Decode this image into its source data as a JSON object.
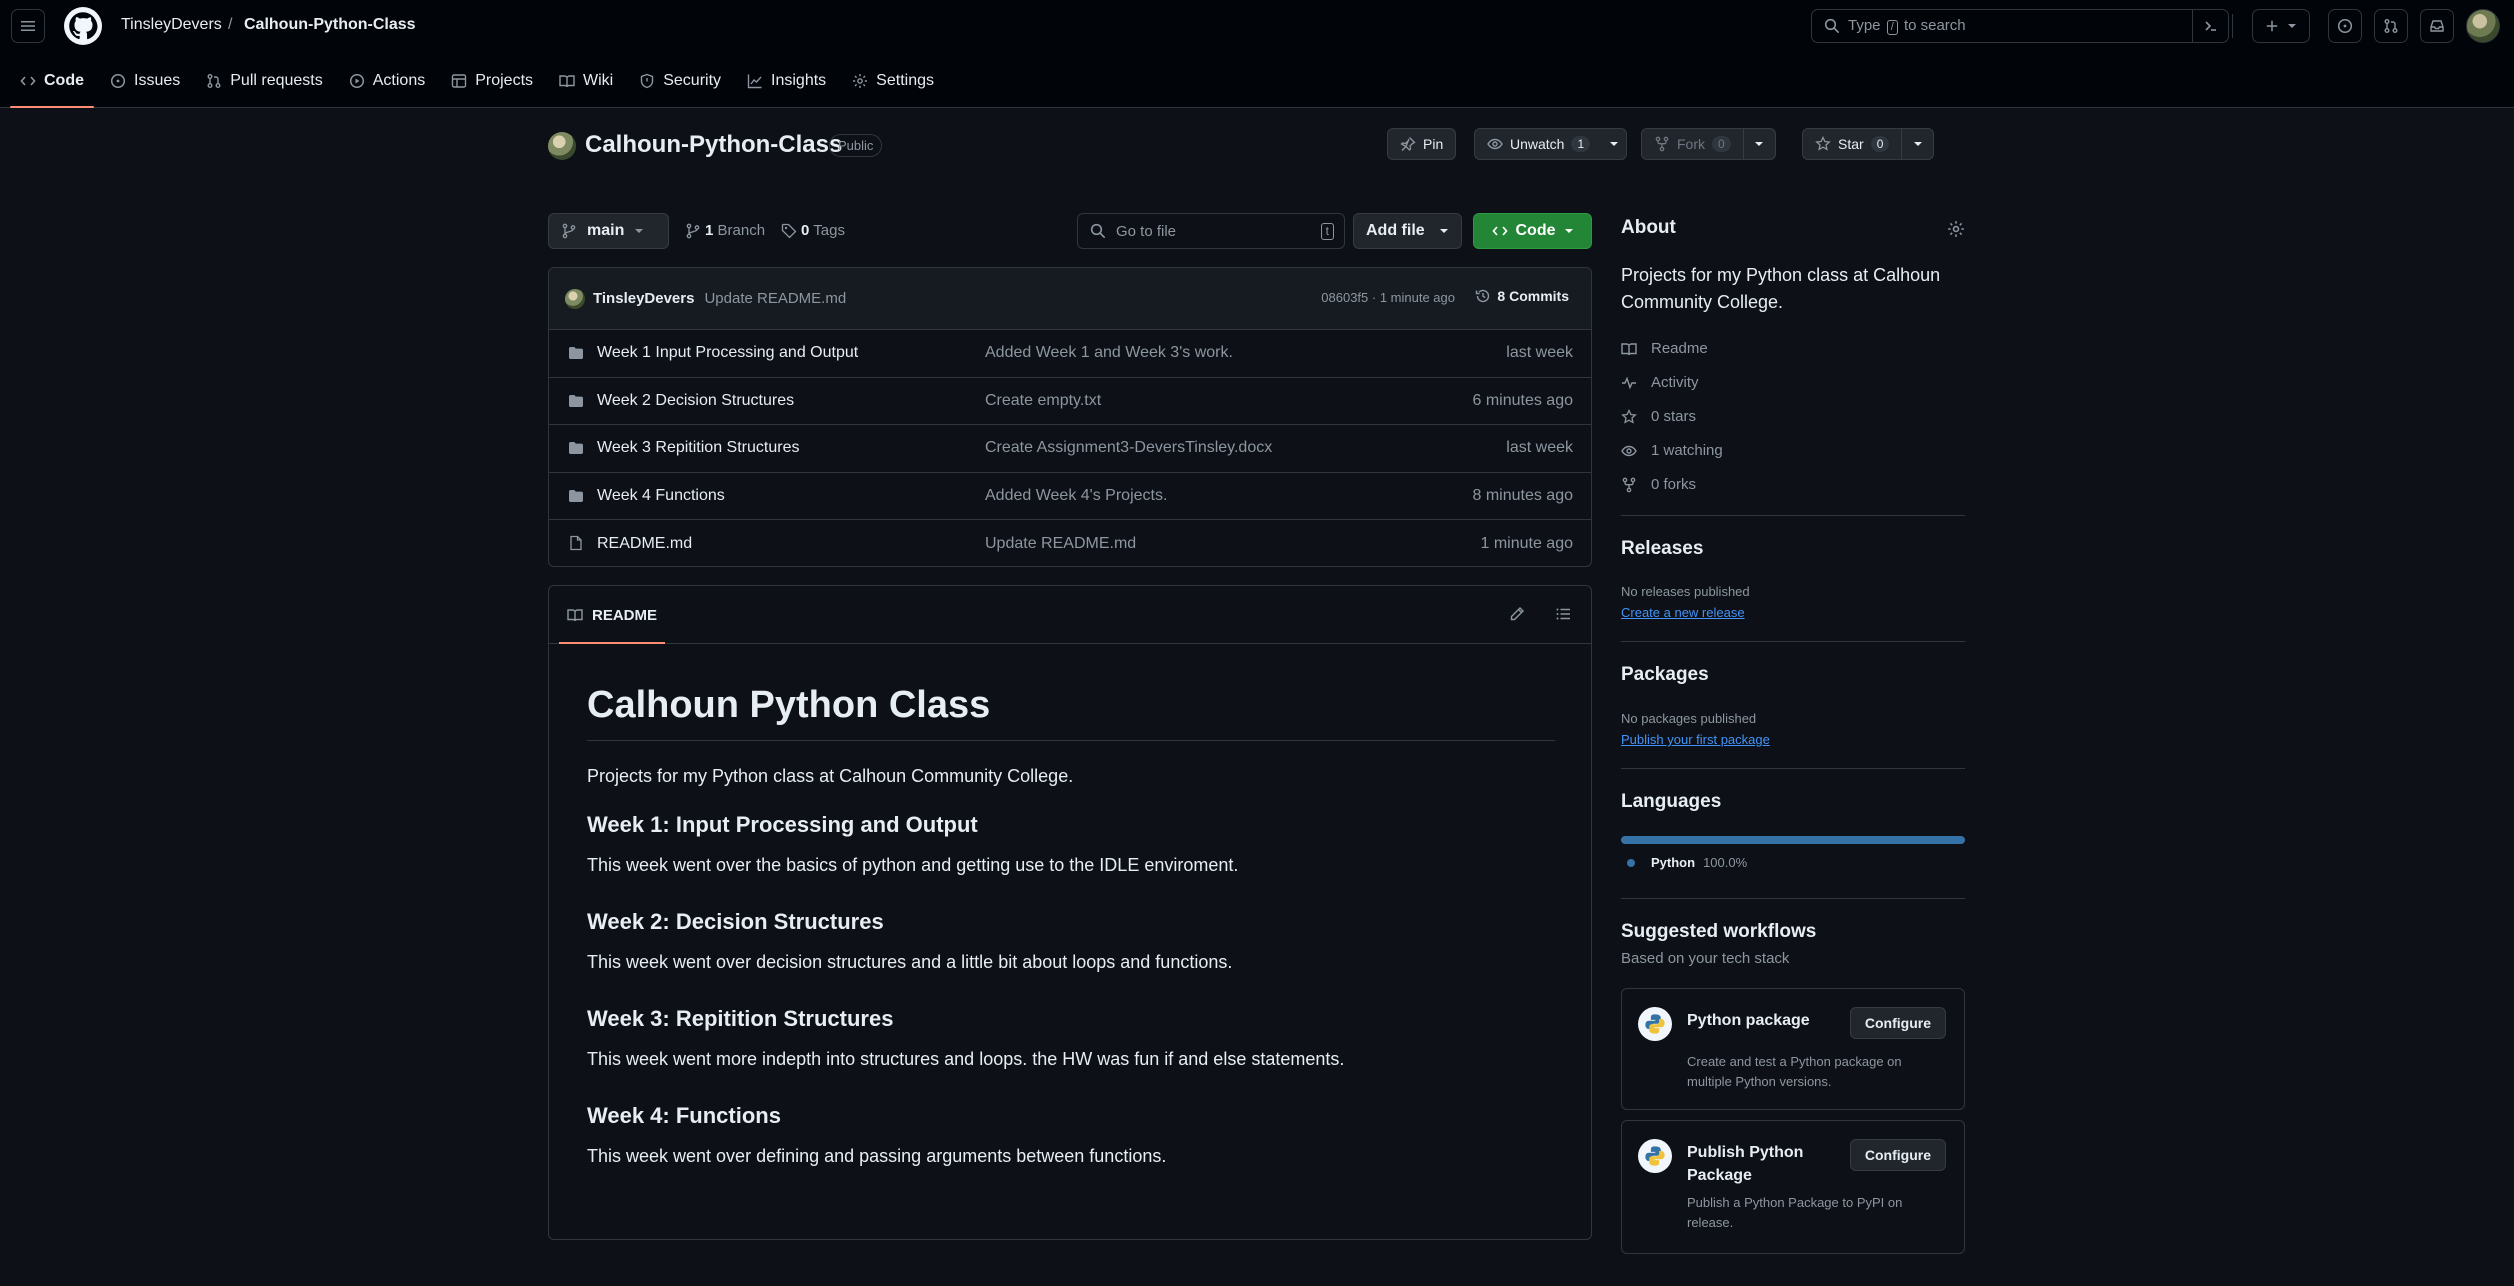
{
  "header": {
    "owner": "TinsleyDevers",
    "separator": "/",
    "repo": "Calhoun-Python-Class",
    "search_pre": "Type",
    "search_key": "/",
    "search_post": "to search"
  },
  "tabs": [
    {
      "label": "Code"
    },
    {
      "label": "Issues"
    },
    {
      "label": "Pull requests"
    },
    {
      "label": "Actions"
    },
    {
      "label": "Projects"
    },
    {
      "label": "Wiki"
    },
    {
      "label": "Security"
    },
    {
      "label": "Insights"
    },
    {
      "label": "Settings"
    }
  ],
  "repo": {
    "name": "Calhoun-Python-Class",
    "visibility": "Public",
    "pin_label": "Pin",
    "unwatch_label": "Unwatch",
    "watch_count": "1",
    "fork_label": "Fork",
    "fork_count": "0",
    "star_label": "Star",
    "star_count": "0"
  },
  "filenav": {
    "branch": "main",
    "branch_count": "1",
    "branch_label": "Branch",
    "tag_count": "0",
    "tag_label": "Tags",
    "goto_placeholder": "Go to file",
    "goto_key": "t",
    "add_file": "Add file",
    "code": "Code"
  },
  "commit": {
    "author": "TinsleyDevers",
    "message": "Update README.md",
    "meta": "08603f5 · 1 minute ago",
    "commits_label": "8 Commits"
  },
  "files": [
    {
      "type": "folder",
      "name": "Week 1 Input Processing and Output",
      "message": "Added Week 1 and Week 3's work.",
      "time": "last week"
    },
    {
      "type": "folder",
      "name": "Week 2 Decision Structures",
      "message": "Create empty.txt",
      "time": "6 minutes ago"
    },
    {
      "type": "folder",
      "name": "Week 3 Repitition Structures",
      "message": "Create Assignment3-DeversTinsley.docx",
      "time": "last week"
    },
    {
      "type": "folder",
      "name": "Week 4 Functions",
      "message": "Added Week 4's Projects.",
      "time": "8 minutes ago"
    },
    {
      "type": "file",
      "name": "README.md",
      "message": "Update README.md",
      "time": "1 minute ago"
    }
  ],
  "readme": {
    "tab_label": "README",
    "h1": "Calhoun Python Class",
    "intro": "Projects for my Python class at Calhoun Community College.",
    "sections": [
      {
        "title": "Week 1: Input Processing and Output",
        "body": "This week went over the basics of python and getting use to the IDLE enviroment."
      },
      {
        "title": "Week 2: Decision Structures",
        "body": "This week went over decision structures and a little bit about loops and functions."
      },
      {
        "title": "Week 3: Repitition Structures",
        "body": "This week went more indepth into structures and loops. the HW was fun if and else statements."
      },
      {
        "title": "Week 4: Functions",
        "body": "This week went over defining and passing arguments between functions."
      }
    ]
  },
  "sidebar": {
    "about_title": "About",
    "about_desc": "Projects for my Python class at Calhoun Community College.",
    "stats": [
      {
        "icon": "book-icon",
        "label": "Readme"
      },
      {
        "icon": "pulse-icon",
        "label": "Activity"
      },
      {
        "icon": "star-icon",
        "label": "0 stars"
      },
      {
        "icon": "eye-icon",
        "label": "1 watching"
      },
      {
        "icon": "fork-icon",
        "label": "0 forks"
      }
    ],
    "releases_title": "Releases",
    "releases_sub": "No releases published",
    "releases_link": "Create a new release",
    "packages_title": "Packages",
    "packages_sub": "No packages published",
    "packages_link": "Publish your first package",
    "languages_title": "Languages",
    "language_name": "Python",
    "language_pct": "100.0%",
    "language_color": "#3572a5",
    "workflows_title": "Suggested workflows",
    "workflows_sub": "Based on your tech stack",
    "workflows": [
      {
        "title": "Python package",
        "desc": "Create and test a Python package on multiple Python versions.",
        "button": "Configure"
      },
      {
        "title": "Publish Python Package",
        "desc": "Publish a Python Package to PyPI on release.",
        "button": "Configure"
      }
    ]
  },
  "colors": {
    "accent_tab": "#fd8c73",
    "code_button": "#238636",
    "link": "#4493f8"
  }
}
